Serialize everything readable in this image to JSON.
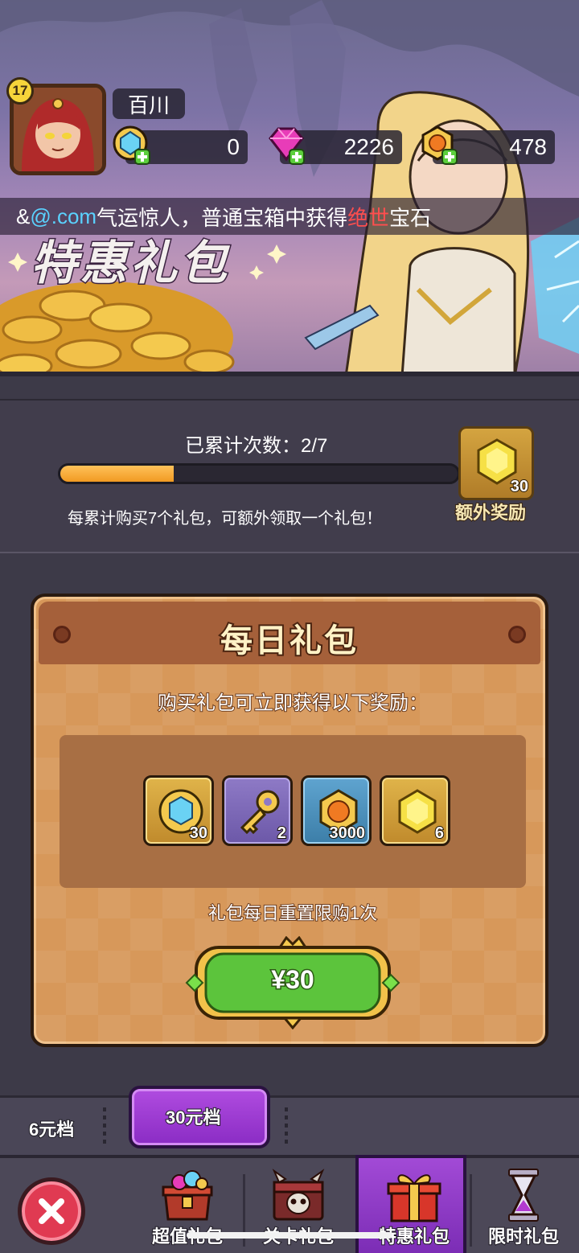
{
  "player": {
    "level": "17",
    "name": "百川"
  },
  "currencies": {
    "blue_gem": "0",
    "pink_diamond": "2226",
    "gold_coin": "478"
  },
  "marquee": {
    "prefix": "&",
    "user": "@.com",
    "text_a": "气运惊人，普通宝箱中获得",
    "highlight": "绝世",
    "text_b": "宝石"
  },
  "banner": {
    "title": "特惠礼包"
  },
  "progress": {
    "label": "已累计次数：2/7",
    "current": 2,
    "total": 7,
    "hint": "每累计购买7个礼包，可额外领取一个礼包！",
    "reward_qty": "30",
    "reward_label": "额外奖励"
  },
  "daily_pack": {
    "title": "每日礼包",
    "subtitle": "购买礼包可立即获得以下奖励：",
    "items": [
      {
        "icon": "blue-gem-icon",
        "qty": "30"
      },
      {
        "icon": "golden-key-icon",
        "qty": "2"
      },
      {
        "icon": "orange-gem-icon",
        "qty": "3000"
      },
      {
        "icon": "yellow-crystal-icon",
        "qty": "6"
      }
    ],
    "limit": "礼包每日重置限购1次",
    "price": "¥30"
  },
  "tiers": {
    "tier_6": "6元档",
    "tier_30": "30元档"
  },
  "nav": {
    "tab_value": "超值礼包",
    "tab_stage": "关卡礼包",
    "tab_special": "特惠礼包",
    "tab_limited": "限时礼包"
  },
  "colors": {
    "accent_purple": "#9a3ed2",
    "progress_orange": "#f5a52c",
    "buy_green": "#5cc43c",
    "close_red": "#e03a52"
  }
}
